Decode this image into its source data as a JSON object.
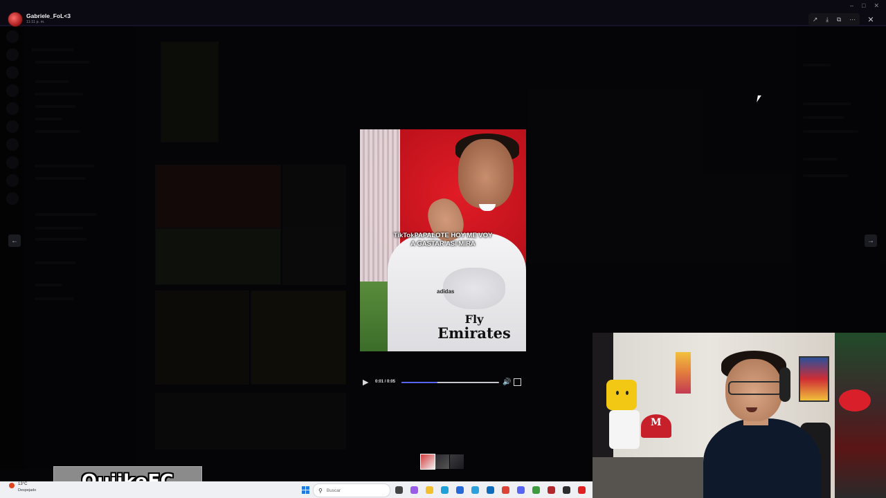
{
  "header": {
    "username": "Gabriele_FoL<3",
    "time": "11:11 p. m.",
    "actions": [
      "forward-icon",
      "download-icon",
      "open-external-icon",
      "more-icon"
    ],
    "close_icon": "close-icon"
  },
  "video": {
    "caption_brand": "TikTok",
    "caption_line1": "PAPALOTE HOY ME VOY",
    "caption_line2": "A GASTAR ASI MIRA",
    "shirt_text_1": "Fly",
    "shirt_text_2": "Emirates",
    "shirt_brand": "adidas",
    "time_display": "0:01 / 0:05",
    "progress": 0.37,
    "accent_color": "#5865f2"
  },
  "thumbnails": [
    {
      "colors": [
        "#d23b3b",
        "#f0f0f0"
      ]
    },
    {
      "colors": [
        "#2a2a30",
        "#555"
      ]
    },
    {
      "colors": [
        "#3a3a3f",
        "#1b1b1f"
      ]
    }
  ],
  "overlay": {
    "logo_text": "QuiikeFC"
  },
  "taskbar": {
    "weather_temp": "13°C",
    "weather_desc": "Despejado",
    "search_placeholder": "Buscar",
    "apps": [
      {
        "name": "windows-start-icon",
        "color": "#1e7be0"
      },
      {
        "name": "task-view-icon",
        "color": "#444"
      },
      {
        "name": "copilot-icon",
        "color": "#9a5ce8"
      },
      {
        "name": "file-explorer-icon",
        "color": "#f2c02c"
      },
      {
        "name": "edge-icon",
        "color": "#1fa0d8"
      },
      {
        "name": "store-icon",
        "color": "#2568d8"
      },
      {
        "name": "telegram-icon",
        "color": "#2aa1dc"
      },
      {
        "name": "outlook-icon",
        "color": "#0f6cbd"
      },
      {
        "name": "chrome-icon",
        "color": "#db4437"
      },
      {
        "name": "discord-icon",
        "color": "#5865f2"
      },
      {
        "name": "xbox-icon",
        "color": "#3c9b3c"
      },
      {
        "name": "app-red-icon",
        "color": "#b3262c"
      },
      {
        "name": "obs-icon",
        "color": "#2c2c2c"
      },
      {
        "name": "record-icon",
        "color": "#e02020"
      }
    ]
  }
}
